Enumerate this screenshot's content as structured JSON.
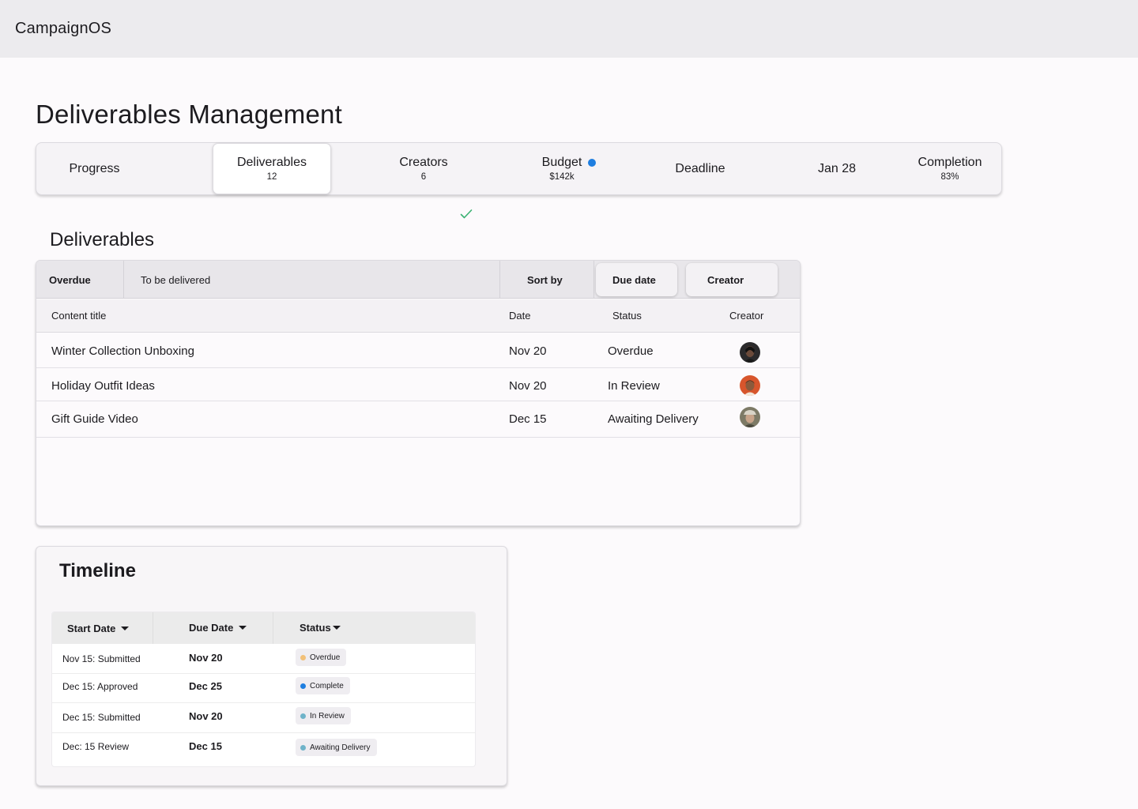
{
  "app": {
    "name": "CampaignOS"
  },
  "page": {
    "title": "Deliverables Management"
  },
  "stats": [
    {
      "label": "Progress",
      "sub": ""
    },
    {
      "label": "Deliverables",
      "sub": "12"
    },
    {
      "label": "Creators",
      "sub": "6"
    },
    {
      "label": "Budget",
      "sub": "$142k"
    },
    {
      "label": "Deadline",
      "sub": ""
    },
    {
      "label": "Jan 28",
      "sub": ""
    },
    {
      "label": "Completion",
      "sub": "83%"
    }
  ],
  "deliverables": {
    "title": "Deliverables",
    "filters": {
      "overdue": "Overdue",
      "to_be_delivered": "To be delivered"
    },
    "sort": {
      "label": "Sort by",
      "due_date": "Due date",
      "creator": "Creator"
    },
    "columns": {
      "title": "Content title",
      "date": "Date",
      "status": "Status",
      "creator": "Creator"
    },
    "rows": [
      {
        "title": "Winter Collection Unboxing",
        "date": "Nov 20",
        "status": "Overdue"
      },
      {
        "title": "Holiday Outfit Ideas",
        "date": "Nov 20",
        "status": "In Review"
      },
      {
        "title": "Gift Guide Video",
        "date": "Dec 15",
        "status": "Awaiting Delivery"
      }
    ]
  },
  "timeline": {
    "title": "Timeline",
    "columns": {
      "start": "Start Date",
      "due": "Due Date",
      "status": "Status"
    },
    "rows": [
      {
        "start": "Nov 15: Submitted",
        "due": "Nov 20",
        "status": "Overdue",
        "color": "#f2c078"
      },
      {
        "start": "Dec 15: Approved",
        "due": "Dec 25",
        "status": "Complete",
        "color": "#1e7ee0"
      },
      {
        "start": "Dec 15:  Submitted",
        "due": "Nov 20",
        "status": "In Review",
        "color": "#6fb3c9"
      },
      {
        "start": "Dec: 15 Review",
        "due": "Dec 15",
        "status": "Awaiting Delivery",
        "color": "#6fb3c9"
      }
    ]
  },
  "colors": {
    "accent": "#1e7ee0",
    "success": "#3bb273"
  }
}
